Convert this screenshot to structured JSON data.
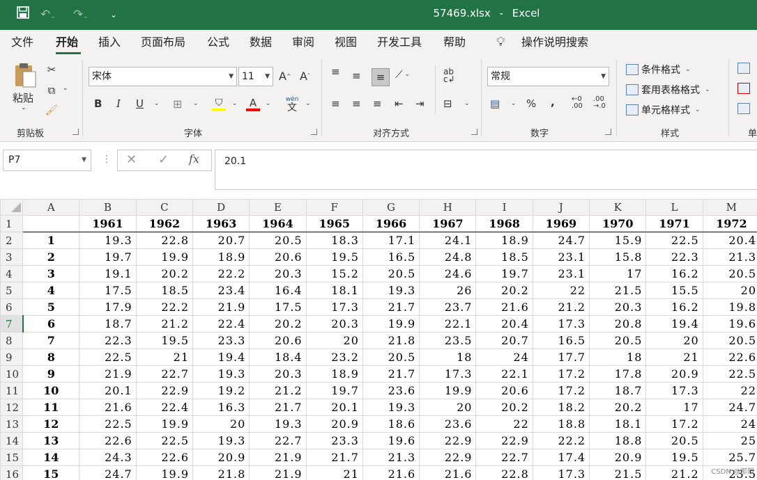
{
  "title_bar": {
    "filename": "57469.xlsx",
    "separator": "-",
    "app_name": "Excel"
  },
  "quick_access": {
    "save_icon": "save-icon",
    "undo_icon": "undo-icon",
    "redo_icon": "redo-icon",
    "customize_icon": "customize-qat-icon"
  },
  "tabs": [
    "文件",
    "开始",
    "插入",
    "页面布局",
    "公式",
    "数据",
    "审阅",
    "视图",
    "开发工具",
    "帮助"
  ],
  "active_tab": "开始",
  "tell_me": "操作说明搜索",
  "ribbon": {
    "clipboard": {
      "paste": "粘贴",
      "label": "剪贴板"
    },
    "font": {
      "name": "宋体",
      "size": "11",
      "bold": "B",
      "italic": "I",
      "underline": "U",
      "font_color_letter": "A",
      "phonetic": "wén",
      "phonetic_char": "文",
      "label": "字体"
    },
    "alignment": {
      "label": "对齐方式"
    },
    "number": {
      "format": "常规",
      "percent": "%",
      "comma": ",",
      "label": "数字"
    },
    "styles": {
      "conditional": "条件格式",
      "table": "套用表格格式",
      "cell": "单元格样式",
      "label": "样式"
    },
    "cells_label": "单"
  },
  "colors": {
    "brand": "#217346",
    "highlight_yellow": "#ffff00",
    "font_red": "#ff0000"
  },
  "name_box": "P7",
  "formula_value": "20.1",
  "fx_label": "fx",
  "columns": [
    "A",
    "B",
    "C",
    "D",
    "E",
    "F",
    "G",
    "H",
    "I",
    "J",
    "K",
    "L",
    "M"
  ],
  "selected_row": 7,
  "header_row": {
    "row": 1,
    "years": [
      "1961",
      "1962",
      "1963",
      "1964",
      "1965",
      "1966",
      "1967",
      "1968",
      "1969",
      "1970",
      "1971",
      "1972"
    ]
  },
  "rows": [
    {
      "row": 2,
      "idx": "1",
      "values": [
        "19.3",
        "22.8",
        "20.7",
        "20.5",
        "18.3",
        "17.1",
        "24.1",
        "18.9",
        "24.7",
        "15.9",
        "22.5",
        "20.4"
      ]
    },
    {
      "row": 3,
      "idx": "2",
      "values": [
        "19.7",
        "19.9",
        "18.9",
        "20.6",
        "19.5",
        "16.5",
        "24.8",
        "18.5",
        "23.1",
        "15.8",
        "22.3",
        "21.3"
      ]
    },
    {
      "row": 4,
      "idx": "3",
      "values": [
        "19.1",
        "20.2",
        "22.2",
        "20.3",
        "15.2",
        "20.5",
        "24.6",
        "19.7",
        "23.1",
        "17",
        "16.2",
        "20.5"
      ]
    },
    {
      "row": 5,
      "idx": "4",
      "values": [
        "17.5",
        "18.5",
        "23.4",
        "16.4",
        "18.1",
        "19.3",
        "26",
        "20.2",
        "22",
        "21.5",
        "15.5",
        "20"
      ]
    },
    {
      "row": 6,
      "idx": "5",
      "values": [
        "17.9",
        "22.2",
        "21.9",
        "17.5",
        "17.3",
        "21.7",
        "23.7",
        "21.6",
        "21.2",
        "20.3",
        "16.2",
        "19.8"
      ]
    },
    {
      "row": 7,
      "idx": "6",
      "values": [
        "18.7",
        "21.2",
        "22.4",
        "20.2",
        "20.3",
        "19.9",
        "22.1",
        "20.4",
        "17.3",
        "20.8",
        "19.4",
        "19.6"
      ]
    },
    {
      "row": 8,
      "idx": "7",
      "values": [
        "22.3",
        "19.5",
        "23.3",
        "20.6",
        "20",
        "21.8",
        "23.5",
        "20.7",
        "16.5",
        "20.5",
        "20",
        "20.5"
      ]
    },
    {
      "row": 9,
      "idx": "8",
      "values": [
        "22.5",
        "21",
        "19.4",
        "18.4",
        "23.2",
        "20.5",
        "18",
        "24",
        "17.7",
        "18",
        "21",
        "22.6"
      ]
    },
    {
      "row": 10,
      "idx": "9",
      "values": [
        "21.9",
        "22.7",
        "19.3",
        "20.3",
        "18.9",
        "21.7",
        "17.3",
        "22.1",
        "17.2",
        "17.8",
        "20.9",
        "22.5"
      ]
    },
    {
      "row": 11,
      "idx": "10",
      "values": [
        "20.1",
        "22.9",
        "19.2",
        "21.2",
        "19.7",
        "23.6",
        "19.9",
        "20.6",
        "17.2",
        "18.7",
        "17.3",
        "22"
      ]
    },
    {
      "row": 12,
      "idx": "11",
      "values": [
        "21.6",
        "22.4",
        "16.3",
        "21.7",
        "20.1",
        "19.3",
        "20",
        "20.2",
        "18.2",
        "20.2",
        "17",
        "24.7"
      ]
    },
    {
      "row": 13,
      "idx": "12",
      "values": [
        "22.5",
        "19.9",
        "20",
        "19.3",
        "20.9",
        "18.6",
        "23.6",
        "22",
        "18.8",
        "18.1",
        "17.2",
        "24"
      ]
    },
    {
      "row": 14,
      "idx": "13",
      "values": [
        "22.6",
        "22.5",
        "19.3",
        "22.7",
        "23.3",
        "19.6",
        "22.9",
        "22.9",
        "22.2",
        "18.8",
        "20.5",
        "25"
      ]
    },
    {
      "row": 15,
      "idx": "14",
      "values": [
        "24.3",
        "22.6",
        "20.9",
        "21.9",
        "21.7",
        "21.3",
        "22.9",
        "22.7",
        "17.4",
        "20.9",
        "19.5",
        "25.7"
      ]
    },
    {
      "row": 16,
      "idx": "15",
      "values": [
        "24.7",
        "19.9",
        "21.8",
        "21.9",
        "21",
        "21.6",
        "21.6",
        "22.8",
        "17.3",
        "21.5",
        "21.2",
        "23.5"
      ]
    }
  ],
  "watermark": "CSDN @那阳"
}
